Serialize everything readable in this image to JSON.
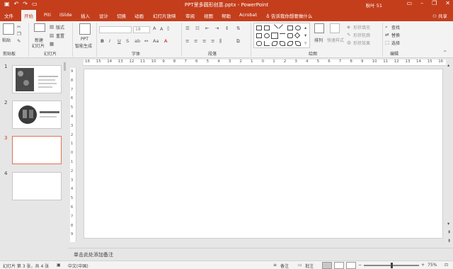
{
  "titlebar": {
    "title": "PPT里多圆形创意.pptx - PowerPoint",
    "user": "秋叶 51",
    "qat_icons": [
      "save-icon",
      "undo-icon",
      "redo-icon",
      "present-icon"
    ],
    "window_controls": [
      "ribbon-display-icon",
      "minimize-icon",
      "restore-icon",
      "close-icon"
    ]
  },
  "tabs": {
    "items": [
      "文件",
      "开始",
      "Piti",
      "iSlide",
      "插入",
      "设计",
      "切换",
      "动画",
      "幻灯片放映",
      "审阅",
      "视图",
      "帮助",
      "Acrobat"
    ],
    "active": "开始",
    "tell_me": "告诉我你想要做什么",
    "share": "共享"
  },
  "ribbon": {
    "clipboard": {
      "paste": "粘贴",
      "label": "剪贴板"
    },
    "slides": {
      "new_slide_1": "新建",
      "new_slide_2": "幻灯片",
      "layout": "版式",
      "reset": "重置",
      "label": "幻灯片"
    },
    "ppt": {
      "line1": "PPT",
      "line2": "智能生成"
    },
    "font": {
      "size": "18",
      "label": "字体",
      "format_buttons": [
        "B",
        "I",
        "U",
        "S"
      ]
    },
    "paragraph": {
      "label": "段落"
    },
    "drawing": {
      "arrange": "排列",
      "quick_styles": "快速样式",
      "fill": "形状填充",
      "outline": "形状轮廓",
      "effect": "形状效果",
      "label": "绘图"
    },
    "editing": {
      "find": "查找",
      "replace": "替换",
      "select": "选择",
      "label": "编辑"
    }
  },
  "slides": [
    {
      "number": "1",
      "selected": false
    },
    {
      "number": "2",
      "selected": false
    },
    {
      "number": "3",
      "selected": true
    },
    {
      "number": "4",
      "selected": false
    }
  ],
  "rulers": {
    "horizontal": [
      "16",
      "15",
      "14",
      "13",
      "12",
      "11",
      "10",
      "9",
      "8",
      "7",
      "6",
      "5",
      "4",
      "3",
      "2",
      "1",
      "0",
      "1",
      "2",
      "3",
      "4",
      "5",
      "6",
      "7",
      "8",
      "9",
      "10",
      "11",
      "12",
      "13",
      "14",
      "15",
      "16"
    ],
    "vertical": [
      "9",
      "8",
      "7",
      "6",
      "5",
      "4",
      "3",
      "2",
      "1",
      "0",
      "1",
      "2",
      "3",
      "4",
      "5",
      "6",
      "7",
      "8",
      "9"
    ]
  },
  "notes_placeholder": "单击此处添加备注",
  "status": {
    "slide_info": "幻灯片 第 3 张，共 4 张",
    "language": "中文(中国)",
    "notes": "备注",
    "comments": "批注",
    "zoom": "75%",
    "zoom_fraction": 0.5
  }
}
